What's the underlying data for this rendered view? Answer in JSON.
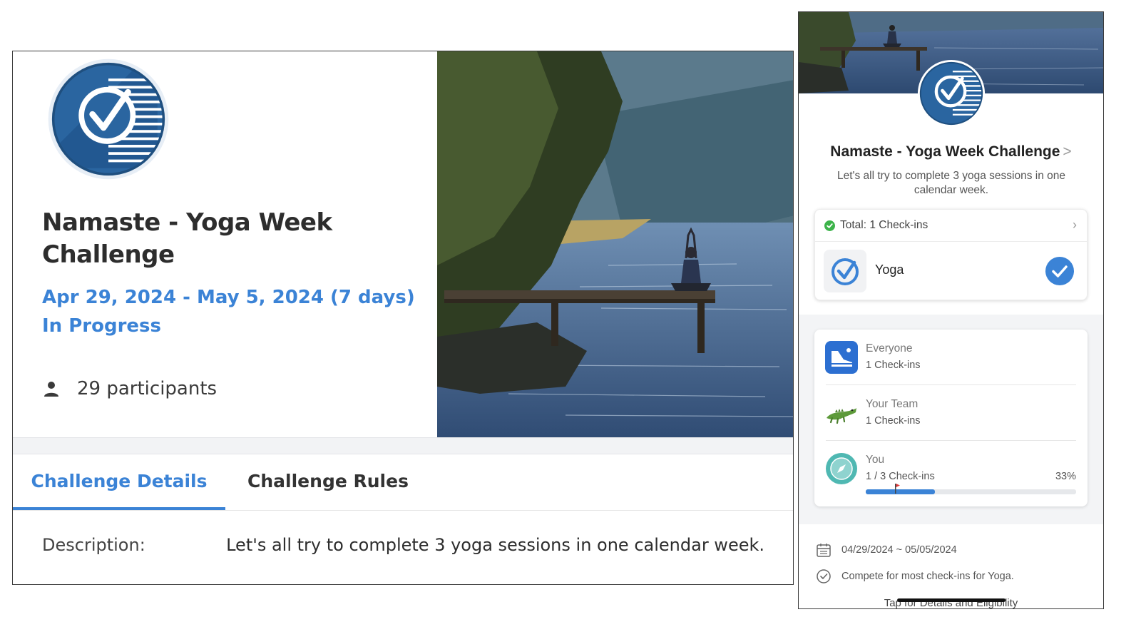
{
  "desktop": {
    "title": "Namaste - Yoga Week Challenge",
    "dates": "Apr 29, 2024 - May 5, 2024 (7 days)",
    "status": "In Progress",
    "participants": "29 participants",
    "tabs": [
      {
        "label": "Challenge Details",
        "active": true
      },
      {
        "label": "Challenge Rules",
        "active": false
      }
    ],
    "description_label": "Description:",
    "description_value": "Let's all try to complete 3 yoga sessions in one calendar week."
  },
  "mobile": {
    "title": "Namaste - Yoga Week Challenge",
    "title_chevron": ">",
    "subtitle": "Let's all try to complete 3 yoga sessions in one calendar week.",
    "total": "Total: 1 Check-ins",
    "activity": "Yoga",
    "leaderboard": [
      {
        "name": "Everyone",
        "count": "1 Check-ins",
        "icon": "shoe-icon"
      },
      {
        "name": "Your Team",
        "count": "1 Check-ins",
        "icon": "crocodile-icon"
      },
      {
        "name": "You",
        "count": "1 / 3 Check-ins",
        "icon": "compass-icon",
        "percent": "33%",
        "progress": 0.33
      }
    ],
    "date_range": "04/29/2024 ~ 05/05/2024",
    "rule": "Compete for most check-ins for Yoga.",
    "link": "Tap for Details and Eligibility"
  },
  "colors": {
    "accent": "#3b83d6",
    "badge_dark": "#1f4f7f",
    "success": "#3cb34a"
  }
}
